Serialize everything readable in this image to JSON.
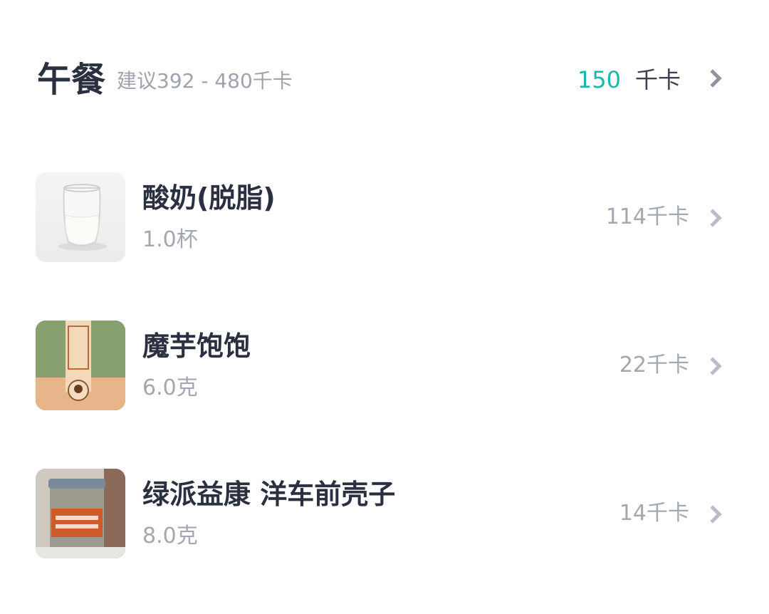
{
  "meal": {
    "title": "午餐",
    "suggestion": "建议392 - 480千卡",
    "total_value": "150",
    "total_unit": "千卡"
  },
  "foods": [
    {
      "name": "酸奶(脱脂)",
      "amount": "1.0杯",
      "kcal": "114千卡",
      "image": "glass-of-yogurt"
    },
    {
      "name": "魔芋饱饱",
      "amount": "6.0克",
      "kcal": "22千卡",
      "image": "konjac-package"
    },
    {
      "name": "绿派益康 洋车前壳子",
      "amount": "8.0克",
      "kcal": "14千卡",
      "image": "psyllium-jar"
    }
  ],
  "colors": {
    "accent": "#1ab8ac",
    "title": "#2b3040",
    "secondary": "#a3a7b1",
    "chevron": "#b9bdc8"
  }
}
